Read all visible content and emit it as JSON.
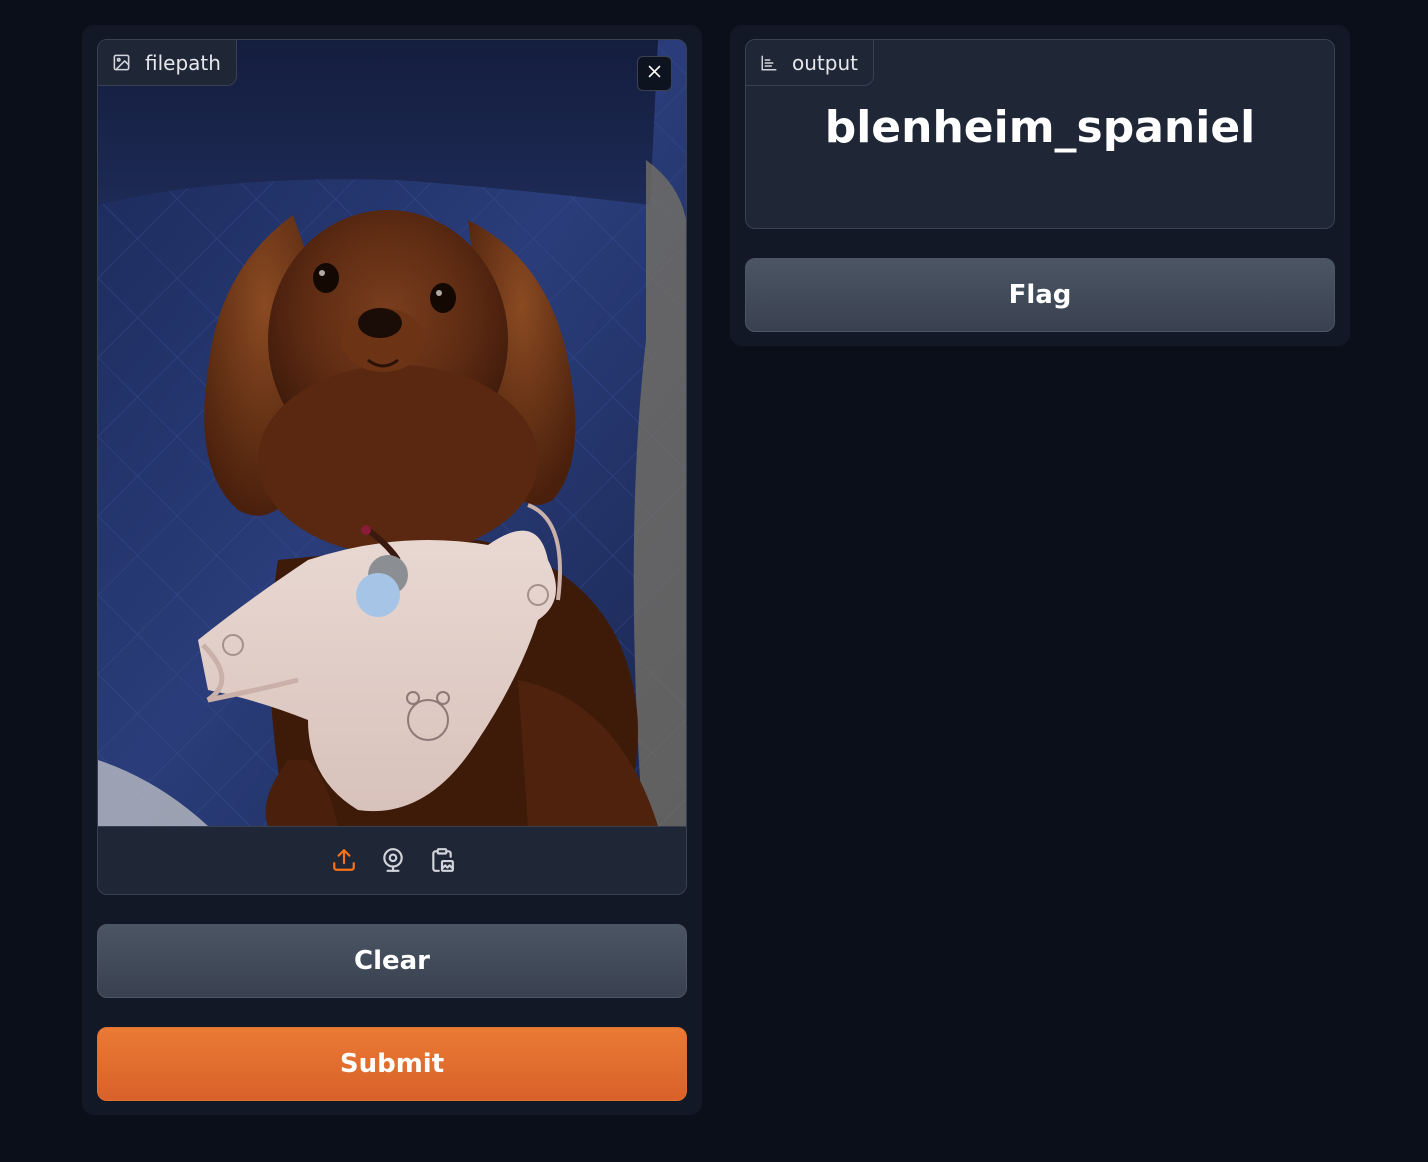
{
  "input": {
    "label": "filepath",
    "label_icon": "image-icon",
    "close_icon": "close-icon",
    "sources": [
      {
        "name": "upload-icon",
        "active": true
      },
      {
        "name": "webcam-icon",
        "active": false
      },
      {
        "name": "clipboard-icon",
        "active": false
      }
    ]
  },
  "buttons": {
    "clear": "Clear",
    "submit": "Submit",
    "flag": "Flag"
  },
  "output": {
    "label": "output",
    "label_icon": "bar-chart-icon",
    "value": "blenheim_spaniel"
  },
  "colors": {
    "background": "#0b0f19",
    "panel": "#121826",
    "block": "#1f2636",
    "primary": "#e0702f",
    "secondary": "#4b5563",
    "active_icon": "#f97316"
  }
}
